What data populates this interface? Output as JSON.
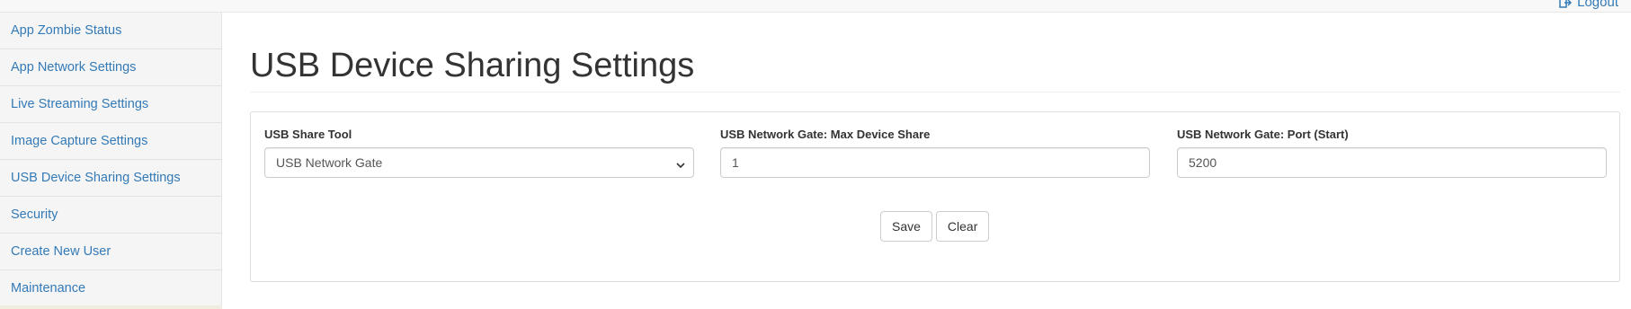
{
  "topbar": {
    "logout_label": "Logout"
  },
  "sidebar": {
    "items": [
      {
        "label": "App Zombie Status"
      },
      {
        "label": "App Network Settings"
      },
      {
        "label": "Live Streaming Settings"
      },
      {
        "label": "Image Capture Settings"
      },
      {
        "label": "USB Device Sharing Settings"
      },
      {
        "label": "Security"
      },
      {
        "label": "Create New User"
      },
      {
        "label": "Maintenance"
      }
    ]
  },
  "main": {
    "title": "USB Device Sharing Settings",
    "form": {
      "share_tool": {
        "label": "USB Share Tool",
        "value": "USB Network Gate"
      },
      "max_device_share": {
        "label": "USB Network Gate: Max Device Share",
        "value": "1"
      },
      "port_start": {
        "label": "USB Network Gate: Port (Start)",
        "value": "5200"
      },
      "save_label": "Save",
      "clear_label": "Clear"
    }
  },
  "icons": {
    "logout": "logout-icon",
    "select_arrow": "chevron-down-icon"
  },
  "colors": {
    "link": "#337ab7",
    "sidebar_bg": "#f5f5f5",
    "text": "#333333"
  }
}
